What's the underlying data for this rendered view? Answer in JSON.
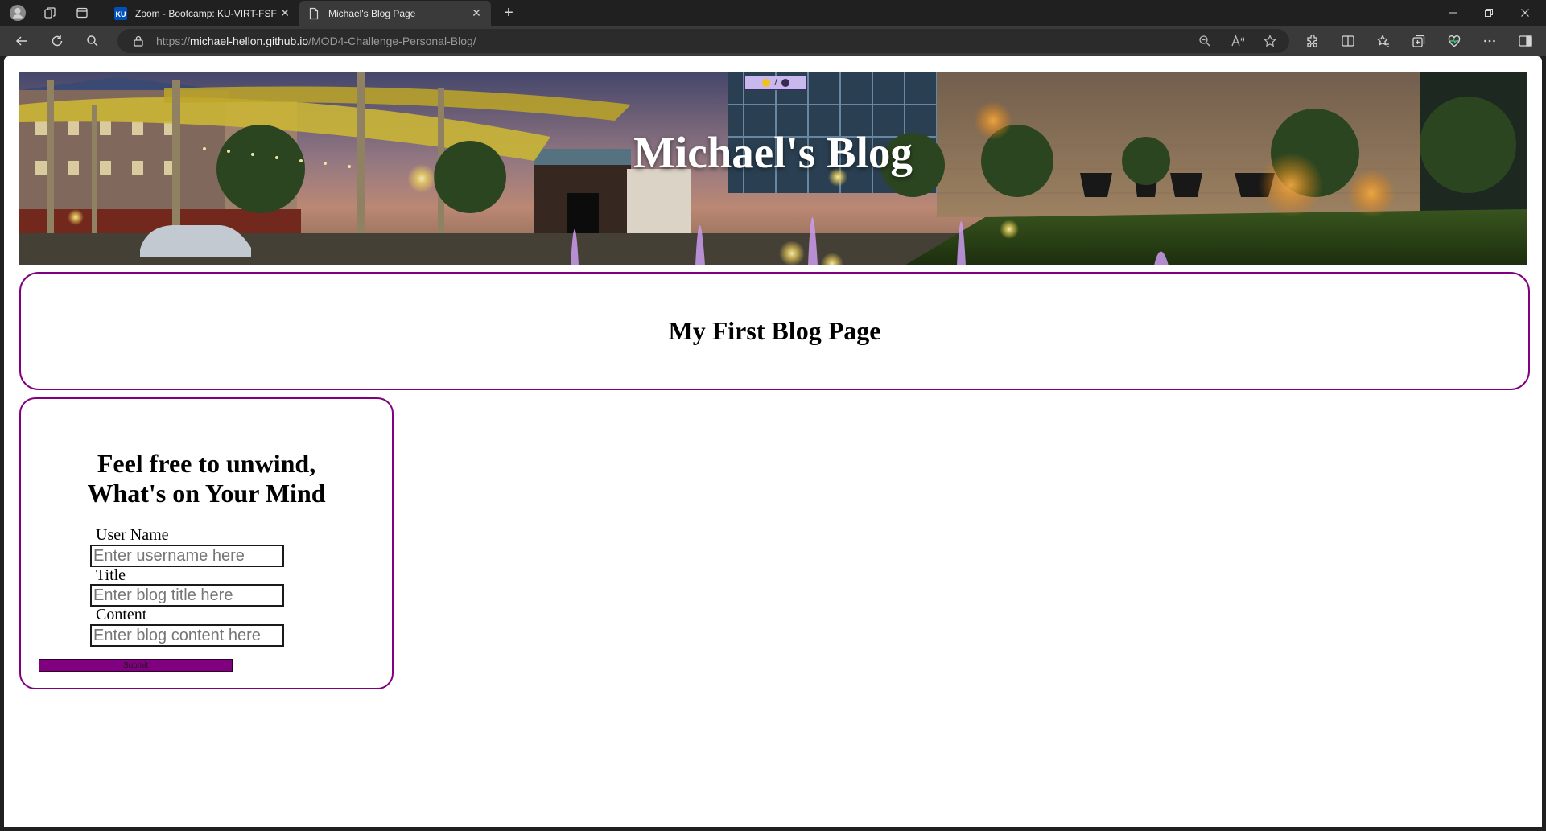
{
  "browser": {
    "tabs": [
      {
        "title": "Zoom - Bootcamp: KU-VIRT-FSF",
        "favicon": "KU"
      },
      {
        "title": "Michael's Blog Page"
      }
    ],
    "address": {
      "scheme": "https://",
      "host": "michael-hellon.github.io",
      "path": "/MOD4-Challenge-Personal-Blog/"
    }
  },
  "page": {
    "hero_title": "Michael's Blog",
    "theme_toggle_separator": "/",
    "banner_heading": "My First Blog Page",
    "form": {
      "heading_line1": "Feel free to unwind,",
      "heading_line2": "What's on Your Mind",
      "username_label": "User Name",
      "username_placeholder": "Enter username here",
      "title_label": "Title",
      "title_placeholder": "Enter blog title here",
      "content_label": "Content",
      "content_placeholder": "Enter blog content here",
      "submit_label": "Submit"
    }
  },
  "colors": {
    "accent": "#800080",
    "chrome_dark": "#202020",
    "chrome_toolbar": "#3a3a3a",
    "toggle_bg": "#c9b8ee"
  }
}
